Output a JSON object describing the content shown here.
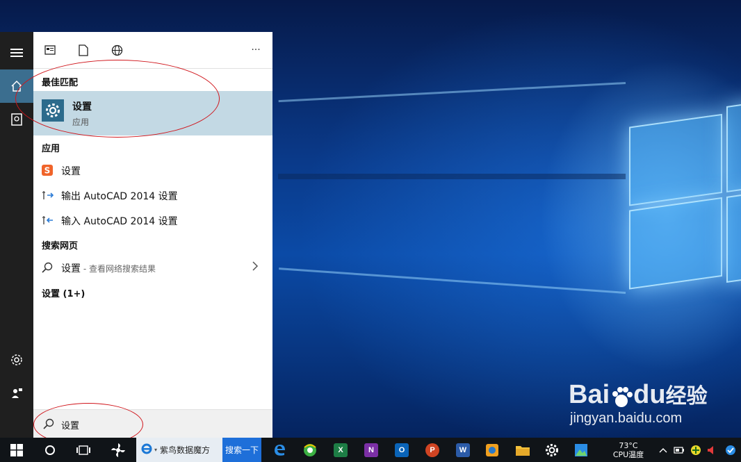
{
  "toolbar": {
    "icons": [
      "apps-view-icon",
      "document-icon",
      "globe-icon"
    ],
    "more": "···"
  },
  "rail": {
    "top_icons": [
      "hamburger-menu-icon",
      "home-icon",
      "notebook-icon"
    ],
    "bottom_icons": [
      "settings-gear-icon",
      "feedback-icon"
    ]
  },
  "results": {
    "best_match_header": "最佳匹配",
    "best_match": {
      "title": "设置",
      "subtitle": "应用",
      "icon": "settings-gear-icon"
    },
    "apps_header": "应用",
    "apps": [
      {
        "label": "设置",
        "icon": "sogou-s-icon"
      },
      {
        "label": "输出 AutoCAD 2014 设置",
        "icon": "export-settings-icon"
      },
      {
        "label": "输入 AutoCAD 2014 设置",
        "icon": "import-settings-icon"
      }
    ],
    "web_header": "搜索网页",
    "web_item": {
      "term": "设置",
      "suffix": " - 查看网络搜索结果"
    },
    "settings_group": "设置 (1+)"
  },
  "search": {
    "value": "设置",
    "icon": "search-icon"
  },
  "taskbar": {
    "browser_label": "紫鸟数据魔方",
    "search_button": "搜索一下",
    "temp_value": "73°C",
    "temp_label": "CPU温度"
  },
  "watermark": {
    "brand": "Bai",
    "brand2": "du",
    "cn": "经验",
    "url": "jingyan.baidu.com"
  },
  "colors": {
    "accent": "#2c6b8c",
    "selection": "#c3d9e4",
    "annotation": "#d0141a",
    "search_button": "#1e6fd9"
  }
}
